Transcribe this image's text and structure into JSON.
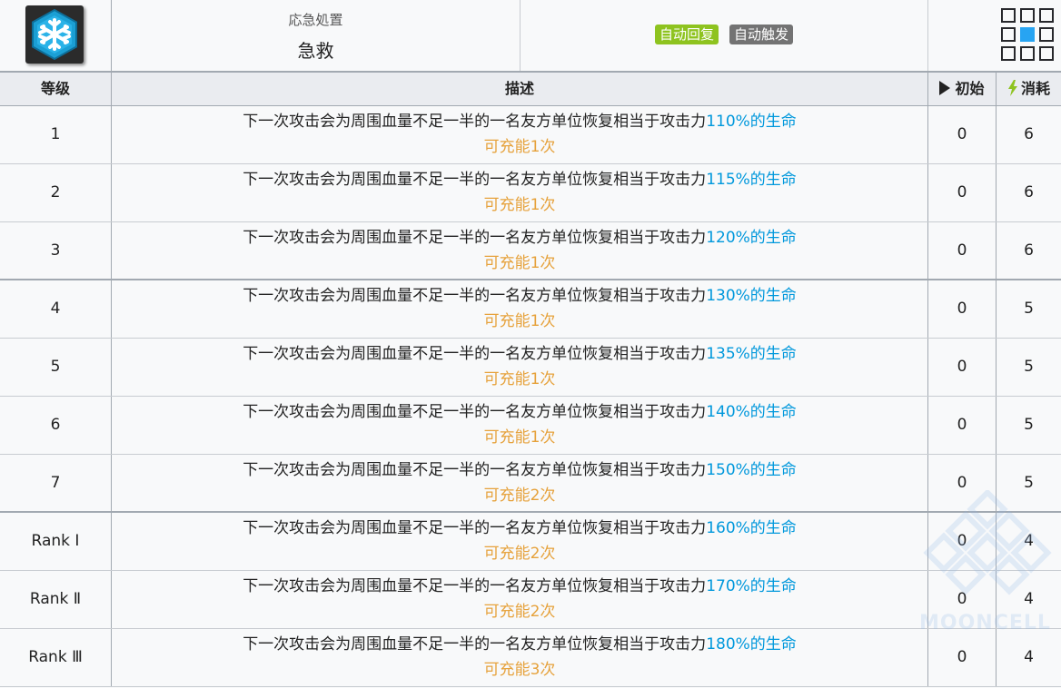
{
  "skill": {
    "type": "応急処置",
    "name": "急救",
    "icon": "snowflake-hexagon-icon"
  },
  "tags": [
    {
      "label": "自动回复",
      "color": "#8ec31f"
    },
    {
      "label": "自动触发",
      "color": "#737373"
    }
  ],
  "range": {
    "cols": 3,
    "rows": 3,
    "self": [
      1,
      1
    ]
  },
  "columns": {
    "level": "等级",
    "desc": "描述",
    "init": "初始",
    "cost": "消耗"
  },
  "desc_prefix": "下一次攻击会为周围血量不足一半的一名友方单位恢复相当于攻击力",
  "desc_suffix": "的生命",
  "rows": [
    {
      "level": "1",
      "pct": "110%",
      "charge": "可充能1次",
      "init": "0",
      "cost": "6"
    },
    {
      "level": "2",
      "pct": "115%",
      "charge": "可充能1次",
      "init": "0",
      "cost": "6"
    },
    {
      "level": "3",
      "pct": "120%",
      "charge": "可充能1次",
      "init": "0",
      "cost": "6"
    },
    {
      "level": "4",
      "pct": "130%",
      "charge": "可充能1次",
      "init": "0",
      "cost": "5"
    },
    {
      "level": "5",
      "pct": "135%",
      "charge": "可充能1次",
      "init": "0",
      "cost": "5"
    },
    {
      "level": "6",
      "pct": "140%",
      "charge": "可充能1次",
      "init": "0",
      "cost": "5"
    },
    {
      "level": "7",
      "pct": "150%",
      "charge": "可充能2次",
      "init": "0",
      "cost": "5"
    },
    {
      "level": "Rank Ⅰ",
      "pct": "160%",
      "charge": "可充能2次",
      "init": "0",
      "cost": "4"
    },
    {
      "level": "Rank Ⅱ",
      "pct": "170%",
      "charge": "可充能2次",
      "init": "0",
      "cost": "4"
    },
    {
      "level": "Rank Ⅲ",
      "pct": "180%",
      "charge": "可充能3次",
      "init": "0",
      "cost": "4"
    }
  ],
  "watermark": "MOONCELL",
  "colors": {
    "highlight": "#0098dc",
    "charge": "#e6a23c",
    "range_self": "#27a4f2"
  }
}
